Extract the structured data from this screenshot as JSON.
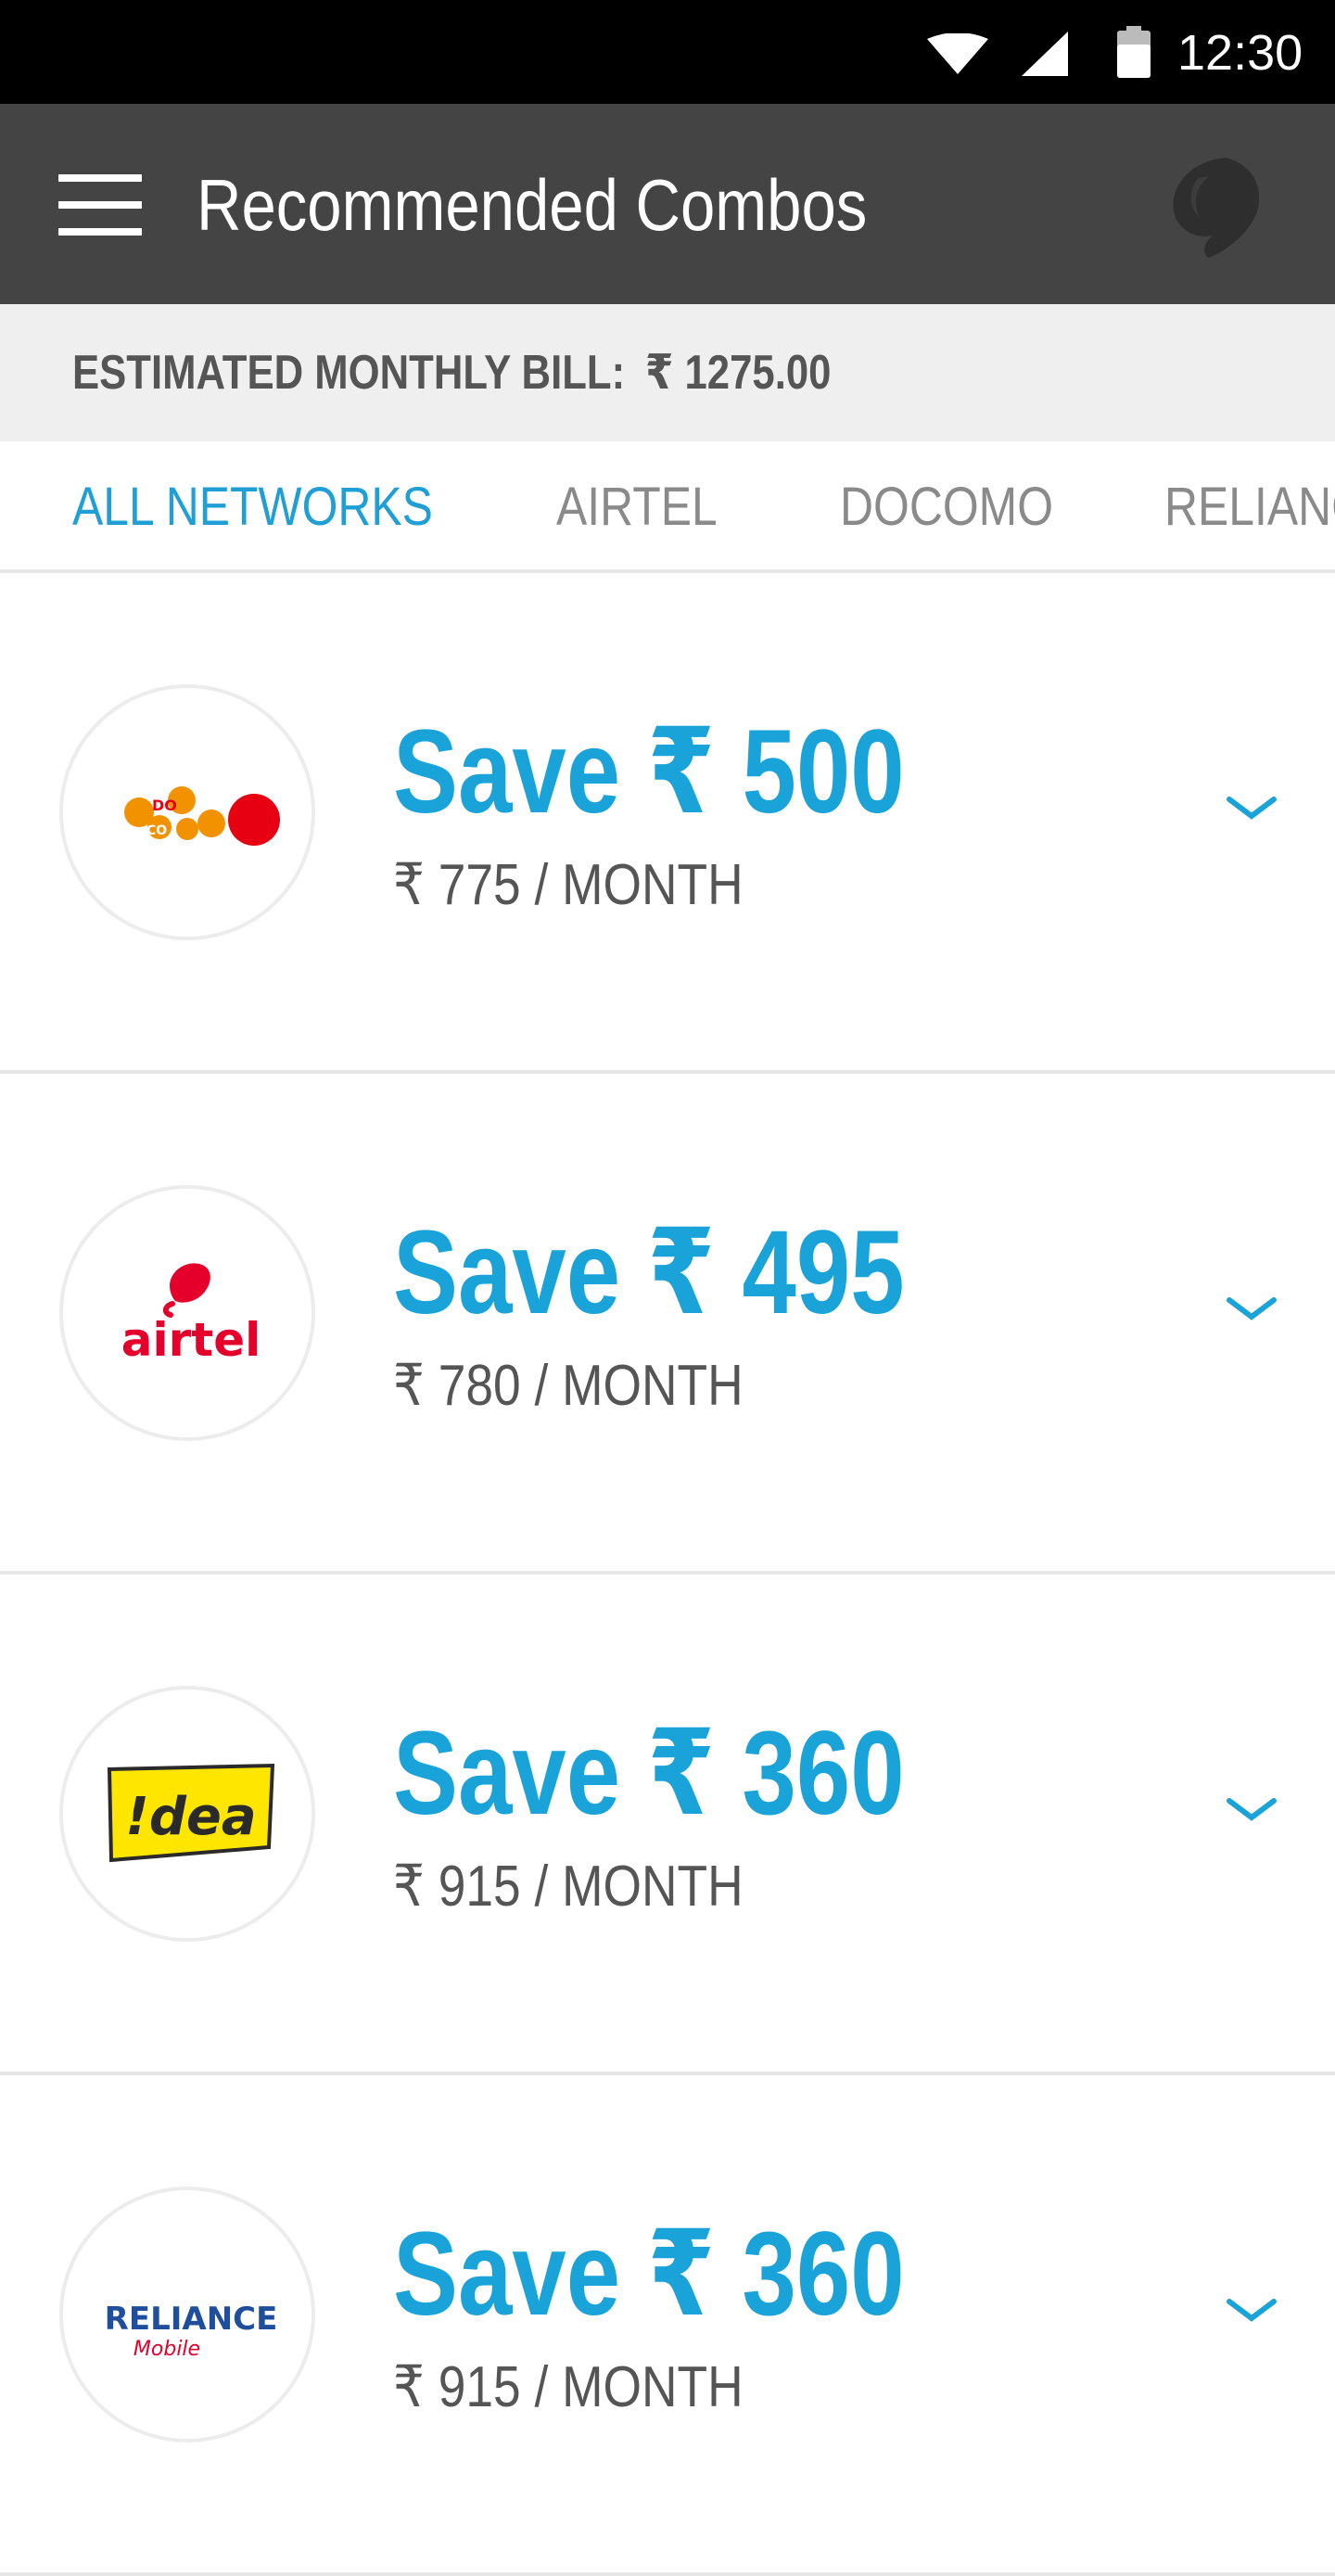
{
  "status_bar": {
    "time": "12:30",
    "icons": [
      "wifi-icon",
      "signal-icon",
      "battery-icon"
    ]
  },
  "app_bar": {
    "title": "Recommended Combos",
    "menu_icon": "menu-icon",
    "brand_icon": "brand-logo-icon",
    "background": "#444444"
  },
  "bill": {
    "label": "ESTIMATED MONTHLY BILL:",
    "amount": "₹ 1275.00"
  },
  "tabs": [
    {
      "label": "ALL NETWORKS",
      "active": true
    },
    {
      "label": "AIRTEL",
      "active": false
    },
    {
      "label": "DOCOMO",
      "active": false
    },
    {
      "label": "RELIANCE",
      "active": false
    }
  ],
  "accent_color": "#1aa3d9",
  "combos": [
    {
      "network": "docomo",
      "logo_text": "DOCOMO",
      "save": "Save ₹ 500",
      "price": "₹ 775 / MONTH"
    },
    {
      "network": "airtel",
      "logo_text": "airtel",
      "save": "Save ₹ 495",
      "price": "₹ 780 / MONTH"
    },
    {
      "network": "idea",
      "logo_text": "!dea",
      "save": "Save ₹ 360",
      "price": "₹ 915 / MONTH"
    },
    {
      "network": "reliance",
      "logo_text": "RELIANCE",
      "logo_subtext": "Mobile",
      "save": "Save ₹ 360",
      "price": "₹ 915 / MONTH"
    }
  ]
}
